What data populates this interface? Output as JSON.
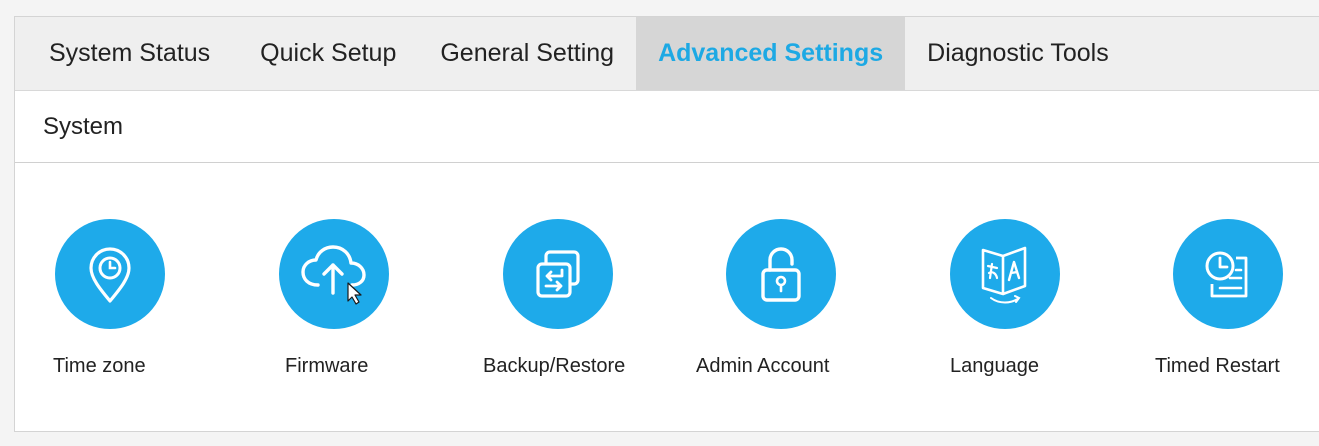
{
  "nav": {
    "tabs": [
      {
        "label": "System Status"
      },
      {
        "label": "Quick Setup"
      },
      {
        "label": "General Setting"
      },
      {
        "label": "Advanced Settings"
      },
      {
        "label": "Diagnostic Tools"
      }
    ],
    "active_tab": "Advanced Settings"
  },
  "section": {
    "title": "System"
  },
  "tiles": [
    {
      "label": "Time zone",
      "icon": "location-clock-icon"
    },
    {
      "label": "Firmware",
      "icon": "cloud-upload-icon"
    },
    {
      "label": "Backup/Restore",
      "icon": "backup-restore-icon"
    },
    {
      "label": "Admin Account",
      "icon": "padlock-icon"
    },
    {
      "label": "Language",
      "icon": "language-book-icon"
    },
    {
      "label": "Timed Restart",
      "icon": "clock-schedule-icon"
    }
  ],
  "colors": {
    "accent": "#1eaaea",
    "active_tab_text": "#1da9e4",
    "active_tab_bg": "#d6d6d6",
    "nav_bg": "#efefef"
  }
}
